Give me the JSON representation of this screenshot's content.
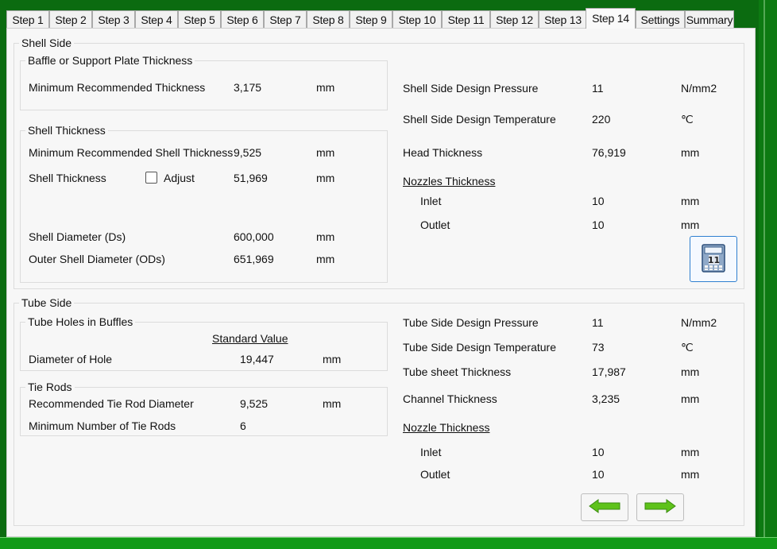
{
  "tabs": [
    "Step 1",
    "Step 2",
    "Step 3",
    "Step 4",
    "Step 5",
    "Step 6",
    "Step 7",
    "Step 8",
    "Step 9",
    "Step 10",
    "Step 11",
    "Step 12",
    "Step 13",
    "Step 14",
    "Settings",
    "Summary"
  ],
  "active_tab": "Step 14",
  "shell": {
    "title": "Shell Side",
    "baffle": {
      "title": "Baffle or Support Plate Thickness",
      "min_label": "Minimum Recommended Thickness",
      "min_value": "3,175",
      "min_unit": "mm"
    },
    "thickness": {
      "title": "Shell Thickness",
      "min_label": "Minimum Recommended Shell Thickness",
      "min_value": "9,525",
      "min_unit": "mm",
      "thick_label": "Shell Thickness",
      "adjust_label": "Adjust",
      "thick_value": "51,969",
      "thick_unit": "mm",
      "diam_label": "Shell Diameter (Ds)",
      "diam_value": "600,000",
      "diam_unit": "mm",
      "outer_label": "Outer Shell Diameter (ODs)",
      "outer_value": "651,969",
      "outer_unit": "mm"
    },
    "pressure_label": "Shell Side Design Pressure",
    "pressure_value": "11",
    "pressure_unit": "N/mm2",
    "temp_label": "Shell Side Design Temperature",
    "temp_value": "220",
    "temp_unit": "℃",
    "head_label": "Head Thickness",
    "head_value": "76,919",
    "head_unit": "mm",
    "nozzles_label": "Nozzles Thickness",
    "inlet_label": "Inlet",
    "inlet_value": "10",
    "inlet_unit": "mm",
    "outlet_label": "Outlet",
    "outlet_value": "10",
    "outlet_unit": "mm"
  },
  "tube": {
    "title": "Tube Side",
    "holes": {
      "title": "Tube Holes in Buffles",
      "std_label": "Standard Value",
      "diam_label": "Diameter of Hole",
      "diam_value": "19,447",
      "diam_unit": "mm"
    },
    "tierods": {
      "title": "Tie Rods",
      "rec_label": "Recommended Tie Rod Diameter",
      "rec_value": "9,525",
      "rec_unit": "mm",
      "min_label": "Minimum Number of Tie Rods",
      "min_value": "6"
    },
    "pressure_label": "Tube Side Design Pressure",
    "pressure_value": "11",
    "pressure_unit": "N/mm2",
    "temp_label": "Tube Side Design Temperature",
    "temp_value": "73",
    "temp_unit": "℃",
    "sheet_label": "Tube sheet Thickness",
    "sheet_value": "17,987",
    "sheet_unit": "mm",
    "channel_label": "Channel Thickness",
    "channel_value": "3,235",
    "channel_unit": "mm",
    "nozzle_label": "Nozzle Thickness",
    "inlet_label": "Inlet",
    "inlet_value": "10",
    "inlet_unit": "mm",
    "outlet_label": "Outlet",
    "outlet_value": "10",
    "outlet_unit": "mm"
  },
  "icons": {
    "calculator": "calculator-icon",
    "back": "arrow-left-icon",
    "next": "arrow-right-icon"
  },
  "colors": {
    "frame_green": "#0b6b10",
    "arrow_green": "#5ec21a",
    "calc_border": "#2f7fd0"
  }
}
